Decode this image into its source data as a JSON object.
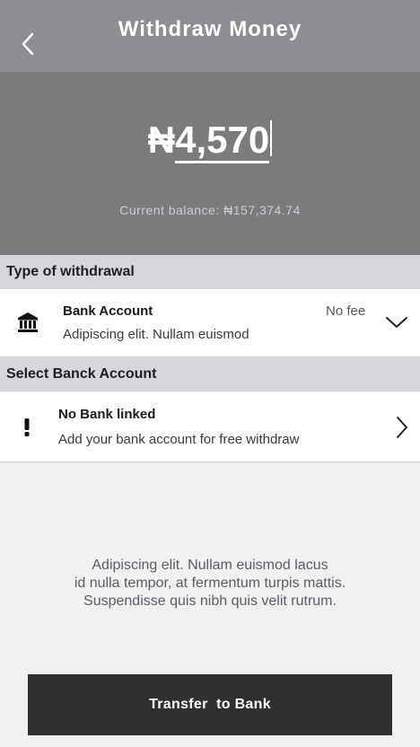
{
  "header": {
    "title": "Withdraw Money",
    "back_icon": "chevron-left-icon"
  },
  "amount": {
    "currency_symbol": "₦",
    "value": "4,570",
    "balance_text": "Current balance: ₦157,374.74"
  },
  "withdrawal_type": {
    "section_title": "Type of withdrawal",
    "icon": "bank-icon",
    "title": "Bank Account",
    "subtitle": "Adipiscing elit. Nullam euismod",
    "fee": "No fee",
    "chevron": "chevron-down-icon"
  },
  "bank_account": {
    "section_title": "Select Banck Account",
    "icon": "exclamation-icon",
    "title": "No Bank linked",
    "subtitle": "Add your bank account for free withdraw",
    "chevron": "chevron-right-icon"
  },
  "info": {
    "line1": "Adipiscing elit. Nullam euismod lacus",
    "line2": "id nulla tempor, at fermentum turpis mattis.",
    "line3": "Suspendisse quis nibh quis velit rutrum."
  },
  "cta": {
    "label": "Transfer  to Bank"
  },
  "colors": {
    "header_bg": "#8e8d92",
    "amount_bg": "#7b7a7d",
    "section_bg": "#d8d6db",
    "button_bg": "#302f32",
    "page_bg": "#f2f0f2"
  }
}
